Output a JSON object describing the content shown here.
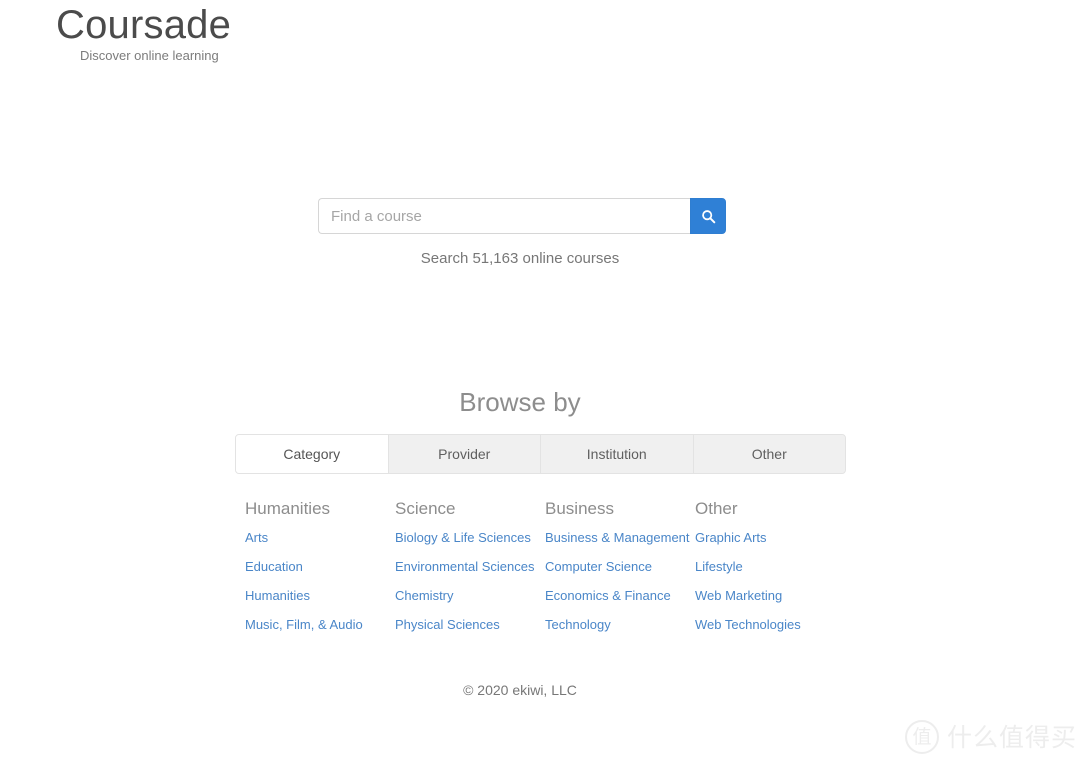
{
  "brand": {
    "name": "Coursade",
    "tagline": "Discover online learning"
  },
  "search": {
    "placeholder": "Find a course",
    "value": "",
    "button_icon": "search-icon",
    "count_text": "Search 51,163 online courses"
  },
  "browse": {
    "title": "Browse by",
    "tabs": [
      {
        "label": "Category",
        "active": true
      },
      {
        "label": "Provider",
        "active": false
      },
      {
        "label": "Institution",
        "active": false
      },
      {
        "label": "Other",
        "active": false
      }
    ],
    "columns": [
      {
        "title": "Humanities",
        "links": [
          "Arts",
          "Education",
          "Humanities",
          "Music, Film, & Audio"
        ]
      },
      {
        "title": "Science",
        "links": [
          "Biology & Life Sciences",
          "Environmental Sciences",
          "Chemistry",
          "Physical Sciences"
        ]
      },
      {
        "title": "Business",
        "links": [
          "Business & Management",
          "Computer Science",
          "Economics & Finance",
          "Technology"
        ]
      },
      {
        "title": "Other",
        "links": [
          "Graphic Arts",
          "Lifestyle",
          "Web Marketing",
          "Web Technologies"
        ]
      }
    ]
  },
  "footer": {
    "copyright": "© 2020 ekiwi, LLC"
  },
  "watermark": {
    "badge": "值",
    "text": "什么值得买"
  },
  "colors": {
    "accent": "#2f80d6",
    "link": "#4a86c8",
    "heading": "#8d8d8d",
    "tab_inactive_bg": "#f0f0f0"
  }
}
